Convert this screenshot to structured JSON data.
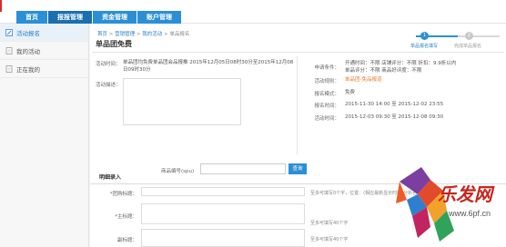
{
  "nav": {
    "items": [
      {
        "label": "首页"
      },
      {
        "label": "报报管理"
      },
      {
        "label": "资金管理"
      },
      {
        "label": "账户管理"
      }
    ]
  },
  "sidebar": {
    "items": [
      {
        "label": "活动报名",
        "icon": "edit-icon"
      },
      {
        "label": "我的活动",
        "icon": "document-icon"
      },
      {
        "label": "正在我的",
        "icon": "document-icon"
      }
    ]
  },
  "breadcrumb": {
    "items": [
      "首页",
      "营销管理",
      "我的活动",
      "单品报名"
    ]
  },
  "page_title": "单品团免费",
  "steps": {
    "items": [
      {
        "num": "1",
        "label": "单品报名填写"
      },
      {
        "num": "2",
        "label": "完成单品报名"
      }
    ]
  },
  "activity": {
    "time_label": "活动时间：",
    "time_value": "单品团均免费单品团会品报推 2015年12月05日08时30分至2015年12月08日09时30分",
    "desc_label": "活动描述：",
    "desc_value": ""
  },
  "details": {
    "rows": [
      {
        "label": "申请条件：",
        "value": "开通时间：不限 店铺评分：不限 折扣：9.9折以内\n单品评分：不限 商品好评度：不限"
      },
      {
        "label": "活动规则：",
        "value": "单品团-免品报道",
        "accent": true
      },
      {
        "label": "报名模式：",
        "value": "免费"
      },
      {
        "label": "报名时间：",
        "value": "2015-11-30 14:00 至 2015-12-02 23:55"
      },
      {
        "label": "活动时间：",
        "value": "2015-12-03 09:30 至 2015-12-08 09:30"
      }
    ]
  },
  "search": {
    "label": "商品编号(spu)",
    "value": "",
    "button_label": "查询"
  },
  "form": {
    "section_title": "明细录入",
    "fields": [
      {
        "label": "*团购标题：",
        "hint": "至多可填写0个字，位置：(相应最新显示时的)分析名"
      },
      {
        "label": "*主标题：",
        "hint": "至多可填写40个字"
      },
      {
        "label": "副标题：",
        "hint": "至多可填写40个字"
      }
    ]
  },
  "watermark": {
    "brand": "乐发网",
    "url": "www.6pf.cn"
  }
}
